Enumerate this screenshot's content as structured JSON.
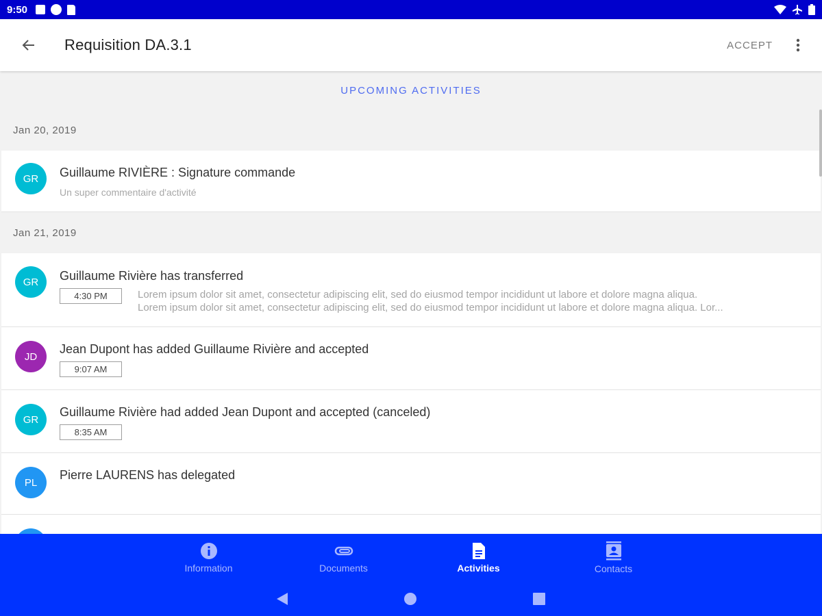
{
  "status_bar": {
    "time": "9:50"
  },
  "app_bar": {
    "title": "Requisition DA.3.1",
    "accept_label": "ACCEPT"
  },
  "upcoming_label": "UPCOMING ACTIVITIES",
  "groups": [
    {
      "date": "Jan 20, 2019",
      "items": [
        {
          "initials": "GR",
          "color": "#00bcd4",
          "title": "Guillaume RIVIÈRE : Signature commande",
          "subtitle": "Un super commentaire d'activité"
        }
      ]
    },
    {
      "date": "Jan 21, 2019",
      "items": [
        {
          "initials": "GR",
          "color": "#00bcd4",
          "title": "Guillaume Rivière has transferred",
          "time": "4:30 PM",
          "desc": [
            "Lorem ipsum dolor sit amet, consectetur adipiscing elit, sed do eiusmod tempor incididunt ut labore et dolore magna aliqua.",
            "Lorem ipsum dolor sit amet, consectetur adipiscing elit, sed do eiusmod tempor incididunt ut labore et dolore magna aliqua. Lor..."
          ]
        },
        {
          "initials": "JD",
          "color": "#9c27b0",
          "title": "Jean Dupont has added Guillaume Rivière and accepted",
          "time": "9:07 AM"
        },
        {
          "initials": "GR",
          "color": "#00bcd4",
          "title": "Guillaume Rivière had added Jean Dupont and accepted (canceled)",
          "time": "8:35 AM"
        },
        {
          "initials": "PL",
          "color": "#2196f3",
          "title": "Pierre LAURENS has delegated"
        }
      ]
    }
  ],
  "bottom_nav": [
    {
      "label": "Information",
      "icon": "info-icon",
      "active": false
    },
    {
      "label": "Documents",
      "icon": "paperclip-icon",
      "active": false
    },
    {
      "label": "Activities",
      "icon": "document-icon",
      "active": true
    },
    {
      "label": "Contacts",
      "icon": "contacts-icon",
      "active": false
    }
  ],
  "colors": {
    "status_bar": "#0000cc",
    "nav_bar": "#0033ff",
    "accent": "#4f6cf0"
  }
}
